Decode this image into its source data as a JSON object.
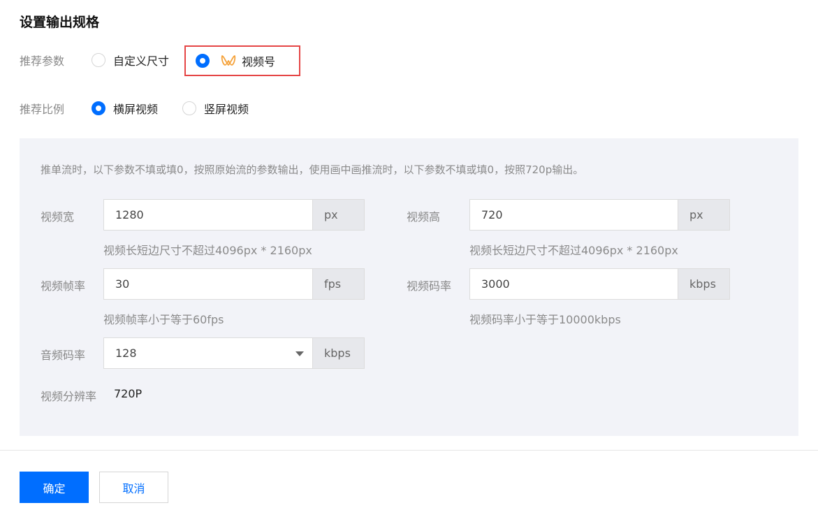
{
  "title": "设置输出规格",
  "recommend": {
    "label": "推荐参数",
    "options": [
      {
        "label": "自定义尺寸",
        "checked": false
      },
      {
        "label": "视频号",
        "checked": true,
        "icon": "wechat-channels-icon"
      }
    ]
  },
  "ratio": {
    "label": "推荐比例",
    "options": [
      {
        "label": "横屏视频",
        "checked": true
      },
      {
        "label": "竖屏视频",
        "checked": false
      }
    ]
  },
  "panel": {
    "note": "推单流时，以下参数不填或填0，按照原始流的参数输出，使用画中画推流时，以下参数不填或填0，按照720p输出。",
    "width": {
      "label": "视频宽",
      "value": "1280",
      "unit": "px",
      "hint": "视频长短边尺寸不超过4096px * 2160px"
    },
    "height": {
      "label": "视频高",
      "value": "720",
      "unit": "px",
      "hint": "视频长短边尺寸不超过4096px * 2160px"
    },
    "fps": {
      "label": "视频帧率",
      "value": "30",
      "unit": "fps",
      "hint": "视频帧率小于等于60fps"
    },
    "bitrate": {
      "label": "视频码率",
      "value": "3000",
      "unit": "kbps",
      "hint": "视频码率小于等于10000kbps"
    },
    "audio_bitrate": {
      "label": "音频码率",
      "value": "128",
      "unit": "kbps"
    },
    "resolution": {
      "label": "视频分辨率",
      "value": "720P"
    }
  },
  "buttons": {
    "confirm": "确定",
    "cancel": "取消"
  },
  "colors": {
    "primary": "#006eff",
    "highlight": "#e54545",
    "panel_bg": "#f2f3f8",
    "icon": "#f5a23a"
  }
}
